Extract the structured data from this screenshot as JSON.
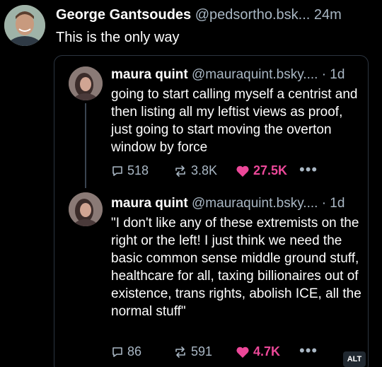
{
  "post": {
    "author_name": "George Gantsoudes",
    "author_handle": "@pedsortho.bsk...",
    "timestamp": "24m",
    "text": "This is the only way"
  },
  "quoted": [
    {
      "author_name": "maura quint",
      "author_handle": "@mauraquint.bsky....",
      "timestamp": "· 1d",
      "text": "going to start calling myself a centrist and then listing all my leftist views as proof, just going to start moving the overton window by force",
      "replies": "518",
      "reposts": "3.8K",
      "likes": "27.5K"
    },
    {
      "author_name": "maura quint",
      "author_handle": "@mauraquint.bsky....",
      "timestamp": "· 1d",
      "text": "\"I don't like any of these extremists on the right or the left! I just think we need the basic common sense middle ground stuff, healthcare for all, taxing billionaires out of existence, trans rights, abolish ICE, all the normal stuff\"",
      "replies": "86",
      "reposts": "591",
      "likes": "4.7K"
    }
  ],
  "more_label": "•••",
  "alt_label": "ALT",
  "icons": [
    "reply-icon",
    "repost-icon",
    "heart-icon",
    "more-icon"
  ],
  "colors": {
    "background": "#000000",
    "handle": "#a9b7c4",
    "like": "#ec4899",
    "border": "#2c3540"
  }
}
